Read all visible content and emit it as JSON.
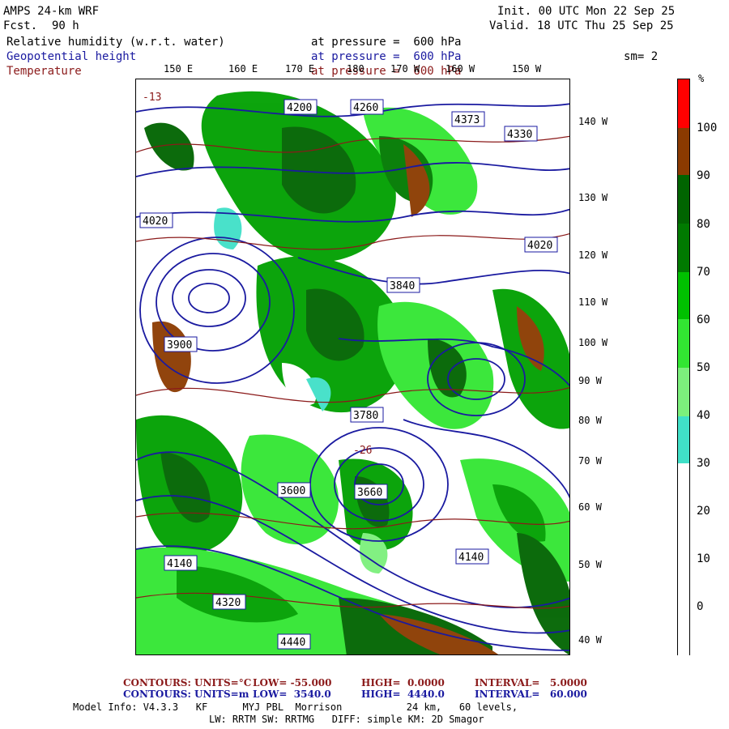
{
  "header": {
    "model": "AMPS 24-km WRF",
    "fcst_label": "Fcst.",
    "fcst_value": "90 h",
    "init": "Init. 00 UTC Mon 22 Sep 25",
    "valid": "Valid. 18 UTC Thu 25 Sep 25",
    "smoothing": "sm= 2"
  },
  "fields": [
    {
      "name": "Relative humidity (w.r.t. water)",
      "level": "at pressure =  600 hPa",
      "color": "#000000"
    },
    {
      "name": "Geopotential height",
      "level": "at pressure =  600 hPa",
      "color": "#1a1aa0"
    },
    {
      "name": "Temperature",
      "level": "at pressure =  600 hPa",
      "color": "#8b1a1a"
    }
  ],
  "longitude_labels": [
    "150 E",
    "160 E",
    "170 E",
    "180",
    "170 W",
    "160 W",
    "150 W"
  ],
  "latitude_labels": [
    "140 W",
    "130 W",
    "120 W",
    "110 W",
    "100 W",
    "90 W",
    "80 W",
    "70 W",
    "60 W",
    "50 W",
    "40 W"
  ],
  "height_contour_labels": [
    "4260",
    "4200",
    "4373",
    "4330",
    "4020",
    "4140",
    "3900",
    "3840",
    "3780",
    "3660",
    "3600",
    "4440",
    "4320"
  ],
  "temperature_contour_labels": [
    "-13",
    "-26"
  ],
  "colorbar": {
    "unit": "%",
    "labels": [
      "100",
      "90",
      "80",
      "70",
      "60",
      "50",
      "40",
      "30",
      "20",
      "10",
      "0"
    ],
    "colors": [
      "#ff0000",
      "#8b3a00",
      "#006400",
      "#008000",
      "#00c000",
      "#32e632",
      "#7cf07c",
      "#40e0c8",
      "#ffffff",
      "#ffffff",
      "#ffffff",
      "#ffffff",
      "#ffffff"
    ]
  },
  "contours": {
    "temperature": {
      "title": "CONTOURS:",
      "units": "UNITS=°C",
      "low": "LOW= -55.000",
      "high": "HIGH=  0.0000",
      "interval": "INTERVAL=   5.0000"
    },
    "height": {
      "title": "CONTOURS:",
      "units": "UNITS=m",
      "low": "LOW=  3540.0",
      "high": "HIGH=  4440.0",
      "interval": "INTERVAL=   60.000"
    }
  },
  "model_info": {
    "line1": "Model Info: V4.3.3   KF      MYJ PBL  Morrison           24 km,   60 levels,",
    "line2": "LW: RRTM SW: RRTMG   DIFF: simple KM: 2D Smagor"
  }
}
